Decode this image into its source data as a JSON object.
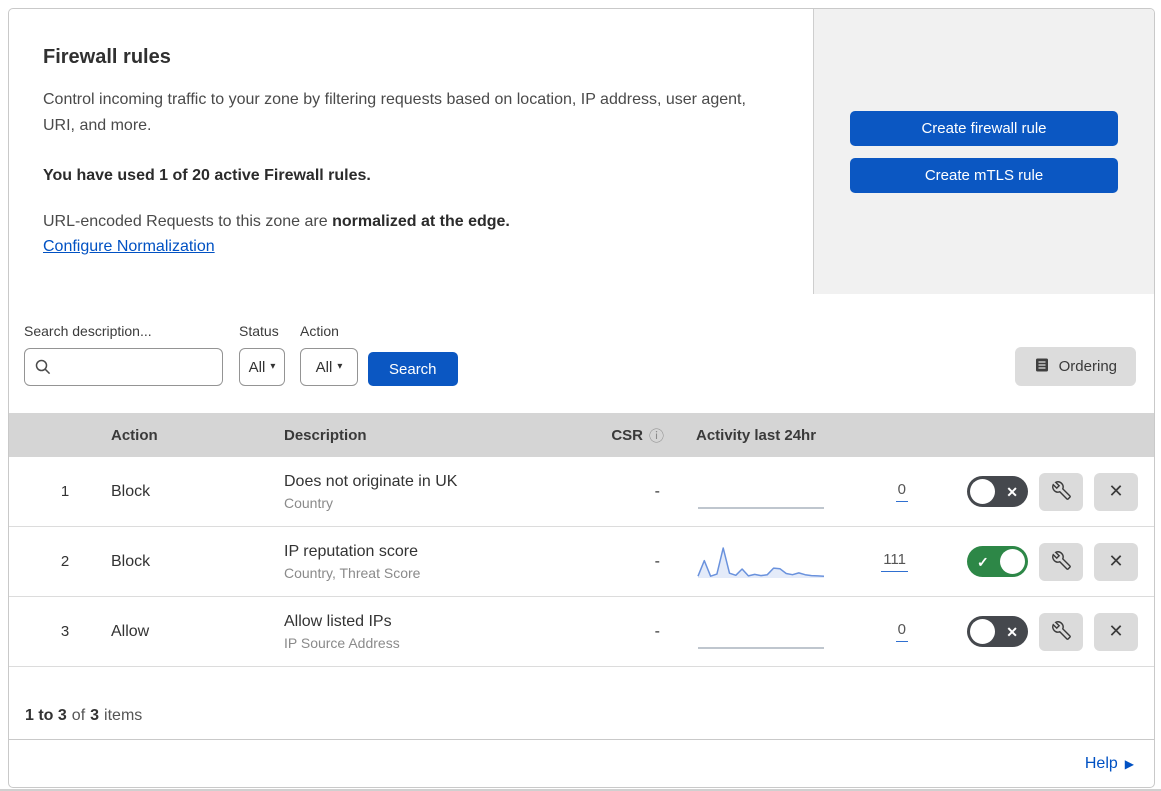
{
  "header": {
    "title": "Firewall rules",
    "description": "Control incoming traffic to your zone by filtering requests based on location, IP address, user agent, URI, and more.",
    "usage_text": "You have used 1 of 20 active Firewall rules.",
    "normalization_text": "URL-encoded Requests to this zone are ",
    "normalization_bold": "normalized at the edge.",
    "normalization_link": "Configure Normalization"
  },
  "actions_panel": {
    "create_firewall_rule": "Create firewall rule",
    "create_mtls_rule": "Create mTLS rule"
  },
  "filters": {
    "search_label": "Search description...",
    "search_value": "",
    "status_label": "Status",
    "status_value": "All",
    "action_label": "Action",
    "action_value": "All",
    "search_button": "Search",
    "ordering_button": "Ordering"
  },
  "table": {
    "headers": {
      "action": "Action",
      "description": "Description",
      "csr": "CSR",
      "activity": "Activity last 24hr"
    },
    "rows": [
      {
        "index": "1",
        "action": "Block",
        "description": "Does not originate in UK",
        "criteria": "Country",
        "csr": "-",
        "count": "0",
        "enabled": false,
        "sparkline": {
          "values": [
            0,
            0,
            0,
            0,
            0,
            0,
            0,
            0,
            0,
            0,
            0,
            0,
            0,
            0,
            0,
            0,
            0,
            0,
            0,
            0,
            0
          ],
          "color": "#aab3bd",
          "fill": false
        }
      },
      {
        "index": "2",
        "action": "Block",
        "description": "IP reputation score",
        "criteria": "Country, Threat Score",
        "csr": "-",
        "count": "111",
        "enabled": true,
        "sparkline": {
          "values": [
            0.06,
            0.58,
            0.06,
            0.13,
            1.0,
            0.16,
            0.09,
            0.3,
            0.07,
            0.12,
            0.08,
            0.11,
            0.33,
            0.31,
            0.15,
            0.11,
            0.17,
            0.11,
            0.08,
            0.07,
            0.06
          ],
          "color": "#6a92dd",
          "fill": true,
          "fill_color": "rgba(106,146,221,0.18)"
        }
      },
      {
        "index": "3",
        "action": "Allow",
        "description": "Allow listed IPs",
        "criteria": "IP Source Address",
        "csr": "-",
        "count": "0",
        "enabled": false,
        "sparkline": {
          "values": [
            0,
            0,
            0,
            0,
            0,
            0,
            0,
            0,
            0,
            0,
            0,
            0,
            0,
            0,
            0,
            0,
            0,
            0,
            0,
            0,
            0
          ],
          "color": "#aab3bd",
          "fill": false
        }
      }
    ]
  },
  "footer": {
    "range": "1 to 3",
    "of": "of",
    "total": "3",
    "items": "items"
  },
  "help": {
    "label": "Help"
  },
  "icons": {
    "dropdown_caret": "▾",
    "check": "✓",
    "cross": "✕",
    "delete_x": "✕",
    "help_arrow": "▶",
    "info": "ⓘ",
    "search": "magnifier-glass",
    "wrench": "spanner",
    "ordering": "list-document"
  },
  "colors": {
    "accent_blue": "#0b57c2",
    "link_blue": "#0051c3",
    "toggle_on_green": "#2d8747",
    "toggle_off_gray": "#45484d",
    "panel_gray": "#f1f1f1",
    "table_header_gray": "#d5d5d5",
    "sparkline_blue": "#6a92dd"
  }
}
